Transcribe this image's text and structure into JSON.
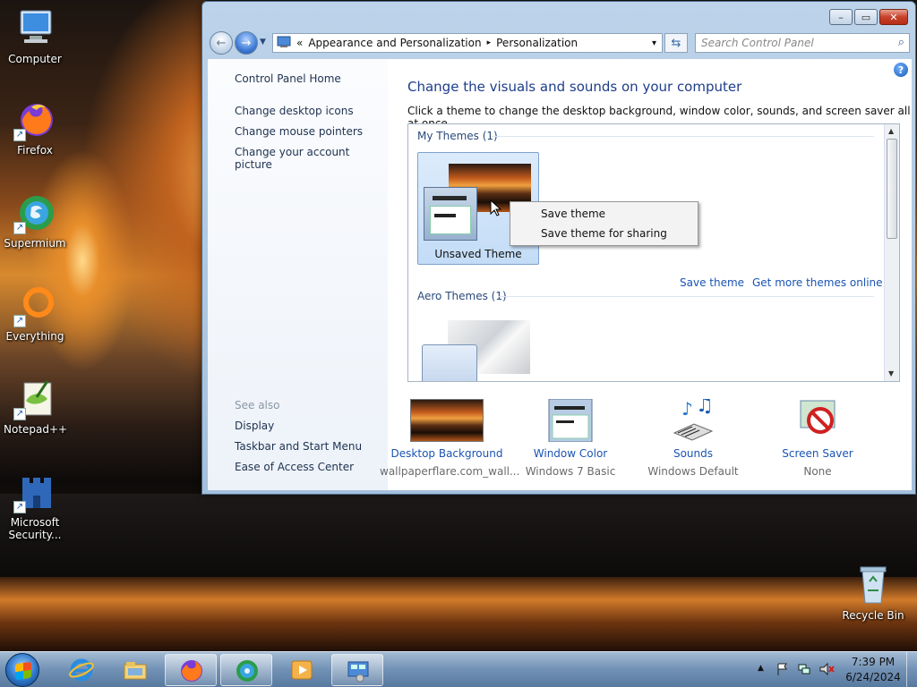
{
  "desktop": {
    "icons": [
      {
        "label": "Computer"
      },
      {
        "label": "Firefox"
      },
      {
        "label": "Supermium"
      },
      {
        "label": "Everything"
      },
      {
        "label": "Notepad++"
      },
      {
        "label": "Microsoft Security..."
      },
      {
        "label": "Recycle Bin"
      }
    ]
  },
  "window": {
    "caption_buttons": {
      "minimize": "–",
      "maximize": "▭",
      "close": "✕"
    },
    "address": {
      "overflow": "«",
      "crumb1": "Appearance and Personalization",
      "sep": "▸",
      "crumb2": "Personalization",
      "dropdown": "▾"
    },
    "search_placeholder": "Search Control Panel",
    "left": {
      "home": "Control Panel Home",
      "links": [
        "Change desktop icons",
        "Change mouse pointers",
        "Change your account picture"
      ],
      "see_also": "See also",
      "see_also_links": [
        "Display",
        "Taskbar and Start Menu",
        "Ease of Access Center"
      ]
    },
    "main": {
      "help": "?",
      "heading": "Change the visuals and sounds on your computer",
      "subheading": "Click a theme to change the desktop background, window color, sounds, and screen saver all at once.",
      "my_themes_label": "My Themes (1)",
      "unsaved_theme": "Unsaved Theme",
      "context_menu": [
        "Save theme",
        "Save theme for sharing"
      ],
      "save_theme_link": "Save theme",
      "more_themes_link": "Get more themes online",
      "aero_label": "Aero Themes (1)",
      "bottom": [
        {
          "label": "Desktop Background",
          "value": "wallpaperflare.com_wall..."
        },
        {
          "label": "Window Color",
          "value": "Windows 7 Basic"
        },
        {
          "label": "Sounds",
          "value": "Windows Default"
        },
        {
          "label": "Screen Saver",
          "value": "None"
        }
      ]
    }
  },
  "taskbar": {
    "clock_time": "7:39 PM",
    "clock_date": "6/24/2024",
    "tray_chevron": "▲"
  }
}
